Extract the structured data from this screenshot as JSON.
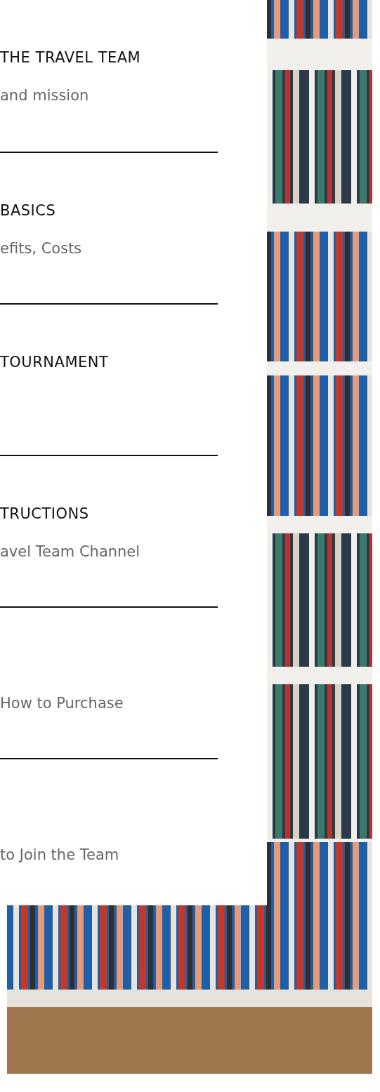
{
  "sections": [
    {
      "heading": "THE TRAVEL TEAM",
      "subtitle": "and mission"
    },
    {
      "heading": "BASICS",
      "subtitle": "efits, Costs"
    },
    {
      "heading": "TOURNAMENT"
    },
    {
      "heading": "TRUCTIONS",
      "subtitle": "avel Team Channel"
    },
    {
      "subtitle": "How to Purchase"
    },
    {
      "subtitle": "to Join the Team"
    }
  ]
}
